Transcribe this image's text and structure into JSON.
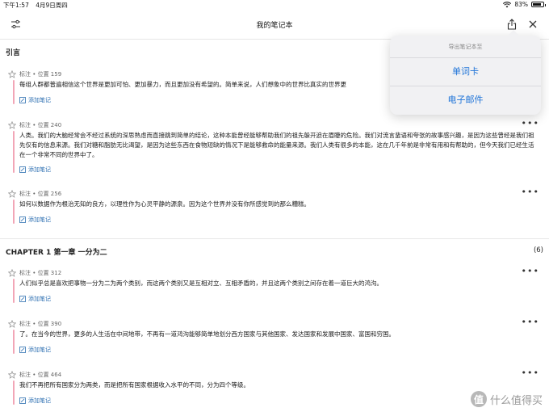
{
  "status_bar": {
    "time": "下午1:57",
    "date": "4月9日周四",
    "battery": "83%"
  },
  "navbar": {
    "title": "我的笔记本"
  },
  "sections": [
    {
      "title": "引言",
      "count": ""
    },
    {
      "title": "CHAPTER 1 第一章 一分为二",
      "count": "(6)"
    }
  ],
  "notes": [
    {
      "meta": "标注 • 位置 159",
      "text": "每组人群都普遍相信这个世界是更加可怕、更加暴力，而且更加没有希望的。简单来说，人们想象中的世界比真实的世界更",
      "add": "添加笔记"
    },
    {
      "meta": "标注 • 位置 240",
      "text": "人类。我们的大脑经常会不经过系统的深思熟虑而直接跳到简单的结论，这种本能曾经能够帮助我们的祖先躲开迫在眉睫的危险。我们对流言蜚语和夸张的故事感兴趣，是因为这些曾经是我们祖先仅有的信息来源。我们对糖和脂肪无比渴望，是因为这些东西在食物短缺的情况下是能够救命的能量来源。我们人类有很多的本能，这在几千年前是非常有用和有帮助的，但今天我们已经生活在一个非常不同的世界中了。",
      "add": "添加笔记"
    },
    {
      "meta": "标注 • 位置 256",
      "text": "如何以数据作为根治无知的良方，以理性作为心灵平静的源泉。因为这个世界并没有你所感觉到的那么糟糕。",
      "add": "添加笔记"
    },
    {
      "meta": "标注 • 位置 312",
      "text": "人们似乎总是喜欢把事物一分为二为两个类别，而这两个类别又是互相对立、互相矛盾的，并且这两个类别之间存在着一道巨大的鸿沟。",
      "add": "添加笔记"
    },
    {
      "meta": "标注 • 位置 390",
      "text": "了。在当今的世界，更多的人生活在中间地带，不再有一道鸿沟能够简单地划分西方国家与其他国家、发达国家和发展中国家、富国和穷国。",
      "add": "添加笔记"
    },
    {
      "meta": "标注 • 位置 464",
      "text": "我们不再把所有国家分为两类，而是把所有国家根据收入水平的不同，分为四个等级。",
      "add": "添加笔记"
    }
  ],
  "popover": {
    "title": "导出笔记本至",
    "option_1": "单词卡",
    "option_2": "电子邮件"
  },
  "watermark": {
    "badge": "值",
    "text": "什么值得买"
  },
  "icons": {
    "filter": "sliders-icon",
    "share": "share-icon",
    "close": "close-icon",
    "star": "star-outline-icon",
    "more": "ellipsis-icon",
    "add_note": "note-pen-icon"
  },
  "colors": {
    "accent": "#1f74d8",
    "link": "#2a6db0",
    "highlight_bar": "#f2a6b7"
  }
}
